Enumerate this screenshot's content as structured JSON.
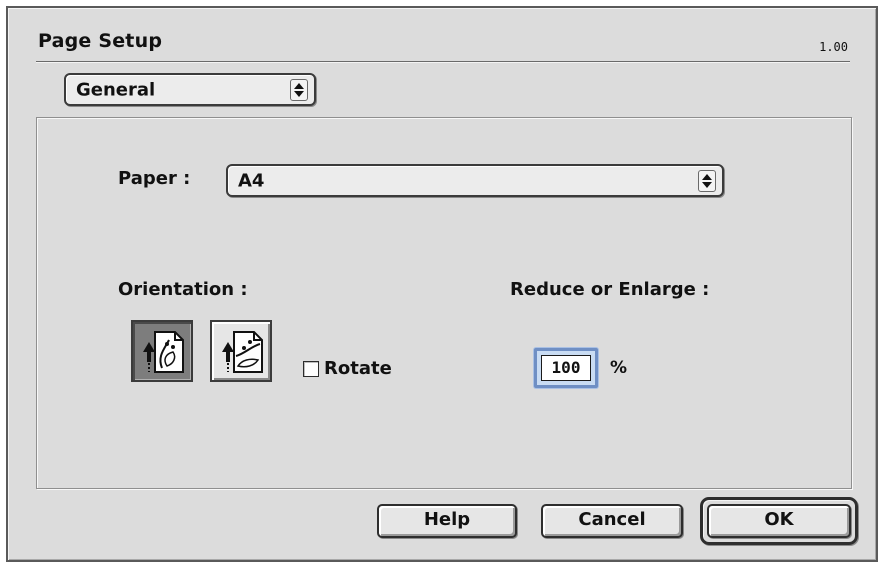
{
  "window": {
    "title": "Page Setup",
    "version": "1.00"
  },
  "category_popup": {
    "selected": "General"
  },
  "paper": {
    "label": "Paper :",
    "selected": "A4"
  },
  "orientation": {
    "label": "Orientation :",
    "options": [
      "portrait",
      "landscape"
    ],
    "selected": "portrait",
    "rotate_label": "Rotate",
    "rotate_checked": false
  },
  "scale": {
    "label": "Reduce or Enlarge :",
    "value": "100",
    "unit": "%"
  },
  "buttons": {
    "help": "Help",
    "cancel": "Cancel",
    "ok": "OK"
  },
  "icons": {
    "popup_arrows": "up-down-arrows-icon",
    "portrait": "portrait-orientation-icon",
    "landscape": "landscape-orientation-icon"
  },
  "colors": {
    "dialog_bg": "#dcdcdc",
    "focus_ring": "#6f8fc4",
    "selected_button": "#7d7d7d"
  }
}
